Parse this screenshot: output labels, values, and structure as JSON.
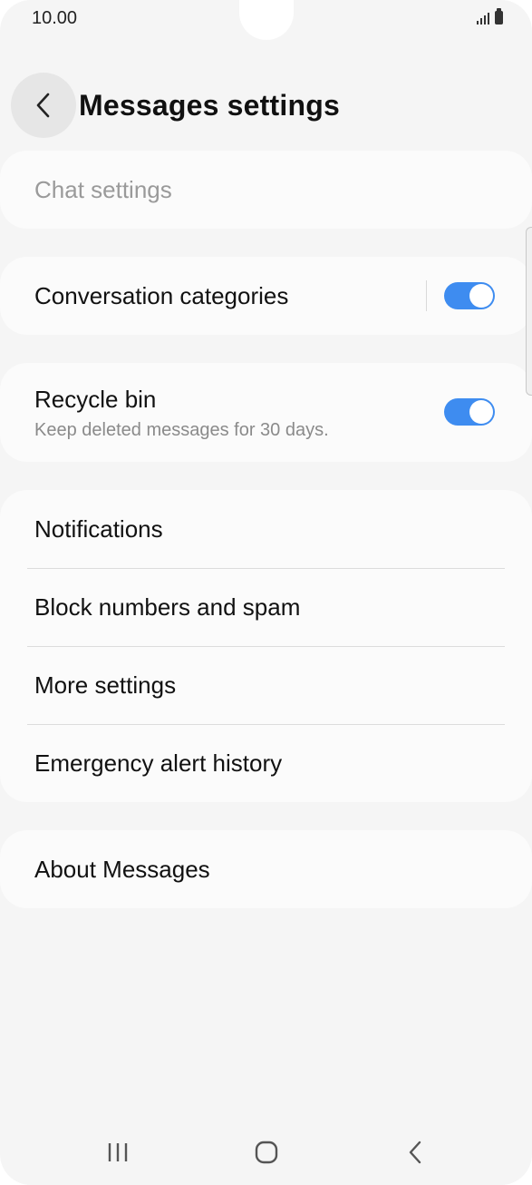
{
  "status_bar": {
    "time": "10.00"
  },
  "header": {
    "title": "Messages settings"
  },
  "sections": {
    "chat_settings": {
      "label": "Chat settings"
    },
    "conversation_categories": {
      "label": "Conversation categories",
      "enabled": true
    },
    "recycle_bin": {
      "label": "Recycle bin",
      "description": "Keep deleted messages for 30 days.",
      "enabled": true
    },
    "menu_items": [
      {
        "label": "Notifications"
      },
      {
        "label": "Block numbers and spam"
      },
      {
        "label": "More settings"
      },
      {
        "label": "Emergency alert history"
      }
    ],
    "about": {
      "label": "About Messages"
    }
  },
  "colors": {
    "accent": "#3e8cf0",
    "background": "#f5f5f5",
    "card": "#fbfbfb"
  },
  "icons": {
    "back": "chevron-left-icon",
    "nav_recents": "recent-apps-icon",
    "nav_home": "home-icon",
    "nav_back": "back-icon"
  }
}
